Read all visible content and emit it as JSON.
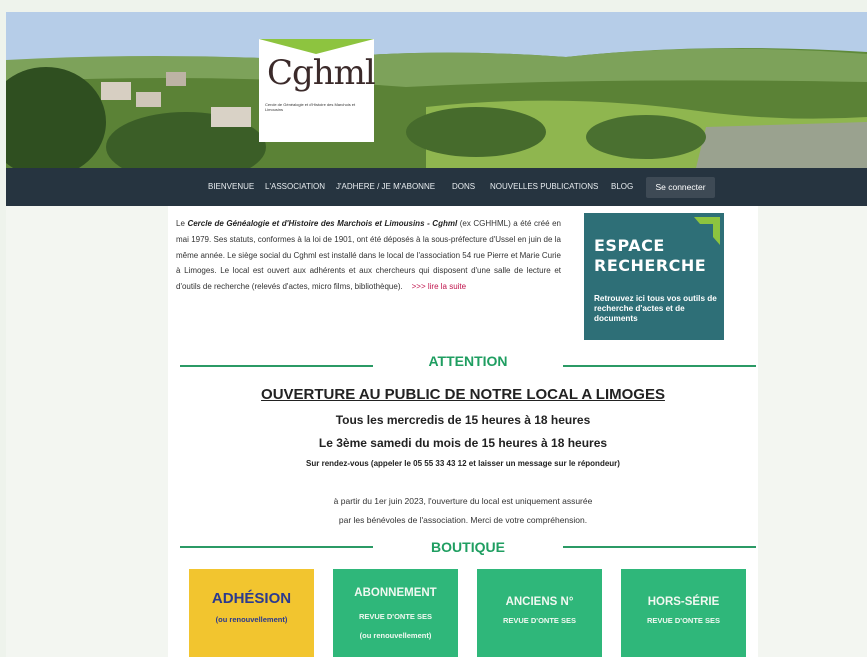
{
  "logo": {
    "name": "Cghml",
    "subtitle": "Cercle de Généalogie et d'Histoire des Marchois et Limousins"
  },
  "nav": {
    "items": [
      "BIENVENUE",
      "L'ASSOCIATION",
      "J'ADHERE / JE M'ABONNE",
      "DONS",
      "NOUVELLES PUBLICATIONS",
      "BLOG"
    ],
    "login": "Se connecter"
  },
  "intro": {
    "prefix": "Le ",
    "org_name": "Cercle de Généalogie et d'Histoire des Marchois et Limousins - Cghml",
    "text": " (ex CGHHML) a été créé en mai 1979. Ses statuts, conformes à la loi de 1901, ont été déposés à la sous-préfecture d'Ussel en juin de la même année. Le siège social du Cghml est installé dans le local de l'association 54 rue Pierre et Marie Curie à Limoges. Le local est ouvert aux adhérents et aux chercheurs qui disposent d'une salle de lecture et d'outils de recherche (relevés d'actes, micro films, bibliothèque).",
    "read_more": ">>> lire la suite"
  },
  "espace": {
    "title_line1": "ESPACE",
    "title_line2": "RECHERCHE",
    "description": "Retrouvez ici tous vos outils de recherche d'actes et de documents"
  },
  "attention": {
    "title": "ATTENTION",
    "heading": "OUVERTURE AU PUBLIC DE NOTRE LOCAL A LIMOGES",
    "line1": "Tous les mercredis de 15 heures à 18 heures",
    "line2": "Le 3ème samedi du mois de 15 heures à 18 heures",
    "line3": "Sur rendez-vous (appeler le 05 55 33 43 12 et laisser un message sur le répondeur)",
    "note1": "à partir du 1er juin 2023, l'ouverture du local est uniquement assurée",
    "note2": "par les bénévoles de l'association. Merci de votre compréhension."
  },
  "boutique": {
    "title": "BOUTIQUE",
    "tiles": [
      {
        "title": "ADHÉSION",
        "sub1": "(ou renouvellement)",
        "sub2": ""
      },
      {
        "title": "ABONNEMENT",
        "sub1": "REVUE D'ONTE SES",
        "sub2": "(ou renouvellement)"
      },
      {
        "title": "ANCIENS N°",
        "sub1": "REVUE D'ONTE SES",
        "sub2": ""
      },
      {
        "title": "HORS-SÉRIE",
        "sub1": "REVUE D'ONTE SES",
        "sub2": ""
      }
    ]
  },
  "colors": {
    "nav_bg": "#263440",
    "accent_green": "#1f9e61",
    "espace_bg": "#2e6f77",
    "tile_yellow": "#f2c52f",
    "tile_green": "#2fb77a"
  }
}
